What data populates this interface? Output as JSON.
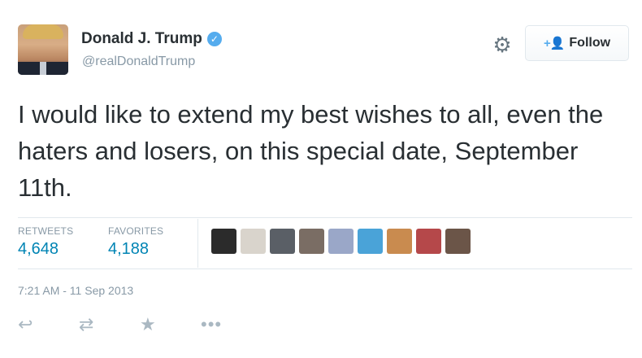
{
  "user": {
    "name": "Donald J. Trump",
    "handle": "@realDonaldTrump",
    "verified": true
  },
  "follow_button": {
    "label": "Follow",
    "icon": "add-user-icon"
  },
  "settings_icon": "gear-icon",
  "tweet": {
    "text": "I would like to extend my best wishes to all, even the haters and losers, on this special date, September 11th."
  },
  "stats": {
    "retweets_label": "RETWEETS",
    "retweets_value": "4,648",
    "favorites_label": "FAVORITES",
    "favorites_value": "4,188"
  },
  "favoriter_avatars": [
    {
      "color": "#2b2b2b"
    },
    {
      "color": "#d9d4cc"
    },
    {
      "color": "#5a5f66"
    },
    {
      "color": "#7a6d64"
    },
    {
      "color": "#9aa7c8"
    },
    {
      "color": "#4aa3d8"
    },
    {
      "color": "#c98b4f"
    },
    {
      "color": "#b5484a"
    },
    {
      "color": "#6b5548"
    }
  ],
  "timestamp": "7:21 AM - 11 Sep 2013",
  "actions": [
    {
      "name": "reply",
      "icon": "reply-icon",
      "glyph": "↩"
    },
    {
      "name": "retweet",
      "icon": "retweet-icon",
      "glyph": "⇄"
    },
    {
      "name": "favorite",
      "icon": "star-icon",
      "glyph": "★"
    },
    {
      "name": "more",
      "icon": "more-icon",
      "glyph": "•••"
    }
  ],
  "colors": {
    "link_blue": "#0084b4",
    "verified_blue": "#55acee",
    "muted_gray": "#8899a6",
    "text": "#292f33"
  }
}
